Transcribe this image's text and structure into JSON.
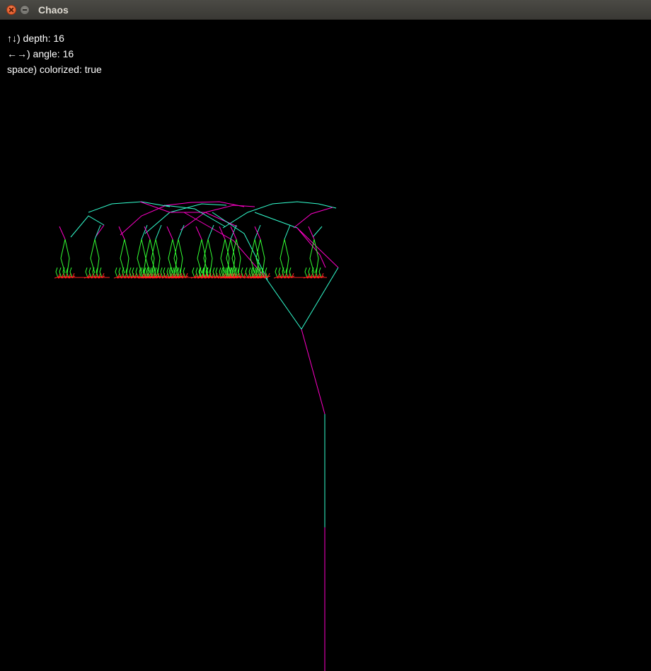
{
  "window": {
    "title": "Chaos"
  },
  "hud": {
    "depth_line": "↑↓) depth: 16",
    "angle_line": "←→) angle: 16",
    "colorized_line": "space) colorized: true"
  },
  "settings": {
    "depth": 16,
    "angle": 16,
    "colorized": true
  },
  "colors": {
    "background": "#000000",
    "magenta": "#ff00c8",
    "cyan": "#33ffd0",
    "green": "#33ff33",
    "red": "#ff2020",
    "titlebar": "#3f3e3a",
    "title_text": "#dfdbd2",
    "hud_text": "#ffffff"
  }
}
